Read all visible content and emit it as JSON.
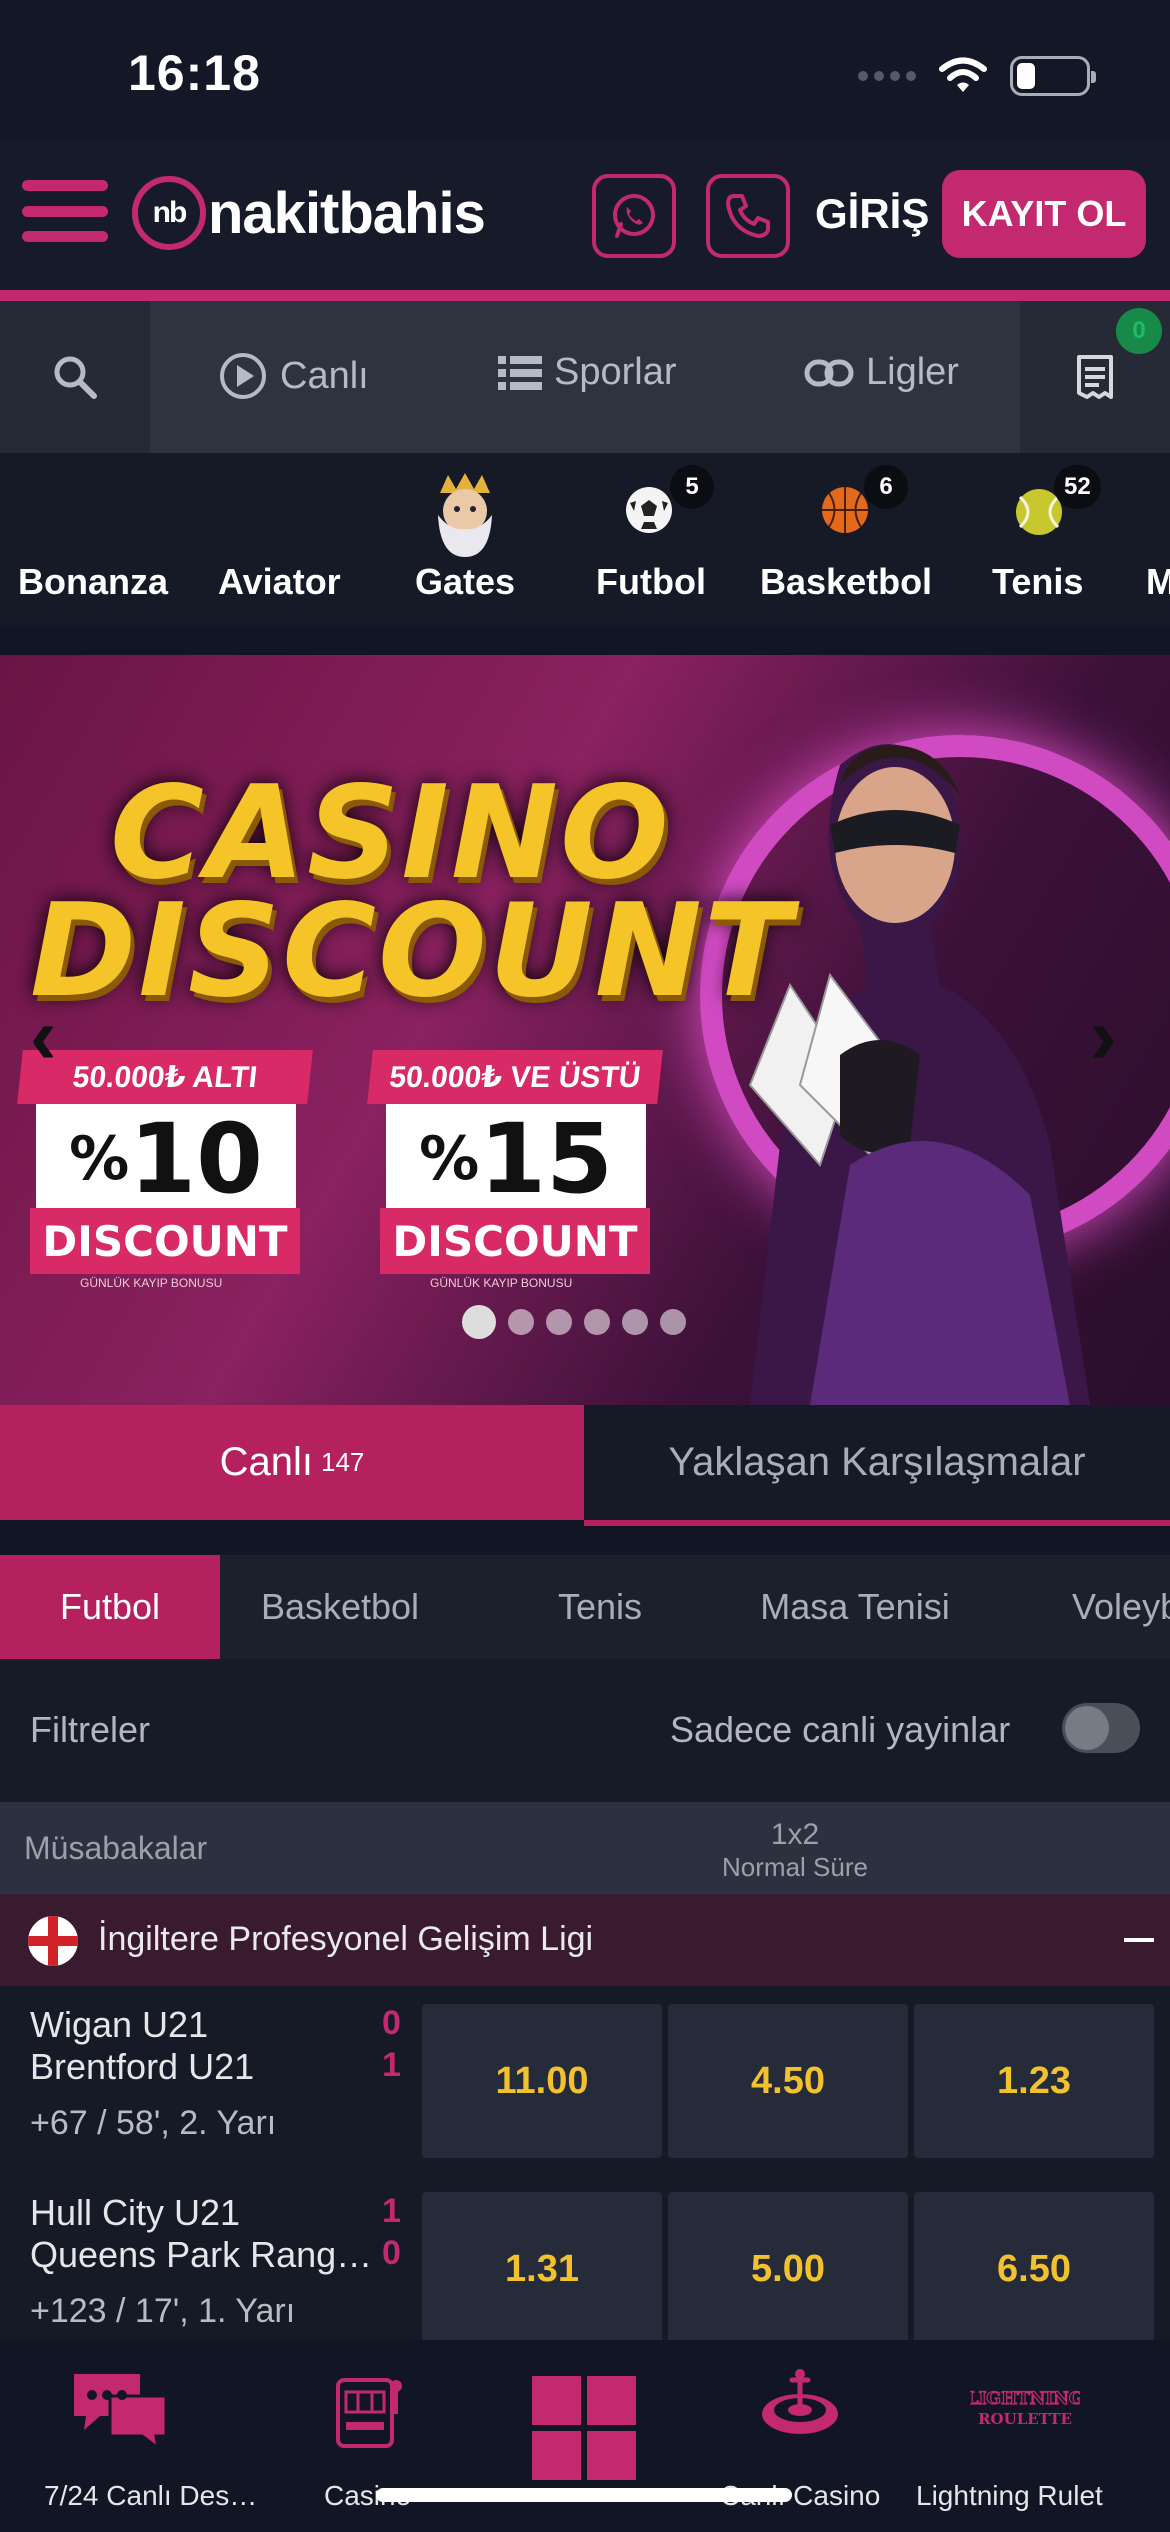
{
  "status_bar": {
    "time": "16:18"
  },
  "header": {
    "logo_mark": "nb",
    "logo_text": "nakitbahis",
    "login_label": "GİRİŞ",
    "register_label": "KAYIT OL",
    "accent_color": "#c2296f"
  },
  "nav": {
    "items": [
      {
        "label": "Canlı",
        "icon": "play-circle-icon"
      },
      {
        "label": "Sporlar",
        "icon": "list-icon"
      },
      {
        "label": "Ligler",
        "icon": "link-icon"
      }
    ],
    "betslip_count": "0"
  },
  "categories": [
    {
      "label": "Bonanza"
    },
    {
      "label": "Aviator"
    },
    {
      "label": "Gates"
    },
    {
      "label": "Futbol",
      "count": "5"
    },
    {
      "label": "Basketbol",
      "count": "6"
    },
    {
      "label": "Tenis",
      "count": "52"
    },
    {
      "label": "M"
    }
  ],
  "banner": {
    "title_line1": "CASINO",
    "title_line2": "DISCOUNT",
    "promo1": {
      "top": "50.000₺ ALTI",
      "percent": "10",
      "bottom": "DISCOUNT",
      "note": "GÜNLÜK KAYIP BONUSU"
    },
    "promo2": {
      "top": "50.000₺ VE ÜSTÜ",
      "percent": "15",
      "bottom": "DISCOUNT",
      "note": "GÜNLÜK KAYIP BONUSU"
    },
    "slide_count": 6,
    "active_slide": 1
  },
  "live_tabs": {
    "live_label": "Canlı",
    "live_count": "147",
    "upcoming_label": "Yaklaşan Karşılaşmalar"
  },
  "sport_tabs": [
    "Futbol",
    "Basketbol",
    "Tenis",
    "Masa Tenisi",
    "Voleyb"
  ],
  "filters": {
    "label": "Filtreler",
    "live_only_label": "Sadece canli yayinlar"
  },
  "table_header": {
    "matches_label": "Müsabakalar",
    "market_label": "1x2",
    "market_sub": "Normal Süre"
  },
  "league": {
    "name": "İngiltere Profesyonel Gelişim Ligi"
  },
  "matches": [
    {
      "home": "Wigan U21",
      "away": "Brentford U21",
      "home_score": "0",
      "away_score": "1",
      "info": "+67 / 58', 2. Yarı",
      "odds": [
        "11.00",
        "4.50",
        "1.23"
      ]
    },
    {
      "home": "Hull City U21",
      "away": "Queens Park Rang…",
      "home_score": "1",
      "away_score": "0",
      "info": "+123 / 17', 1. Yarı",
      "odds": [
        "1.31",
        "5.00",
        "6.50"
      ]
    }
  ],
  "bottom_nav": [
    {
      "label": "7/24 Canlı Des…",
      "icon": "chat-icon"
    },
    {
      "label": "Casino",
      "icon": "slot-machine-icon"
    },
    {
      "label": "",
      "icon": "grid-icon"
    },
    {
      "label": "Canlı Casino",
      "icon": "roulette-icon"
    },
    {
      "label": "Lightning Rulet",
      "icon": "lightning-roulette-icon"
    }
  ]
}
